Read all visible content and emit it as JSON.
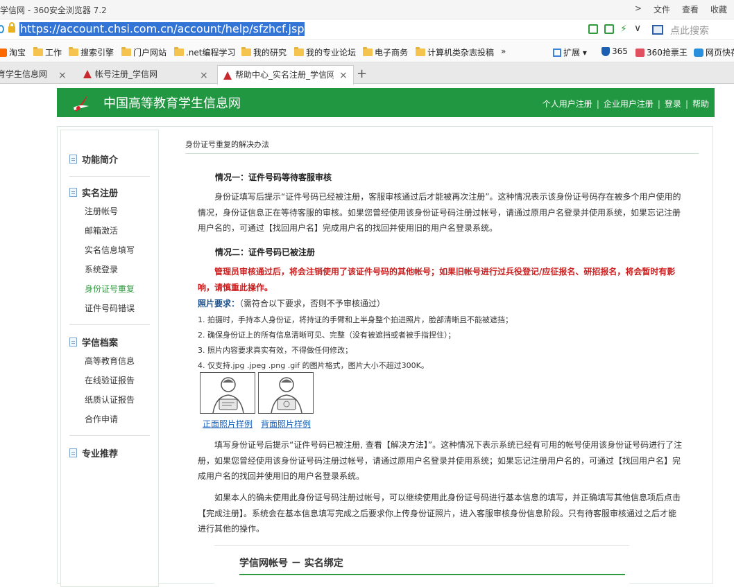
{
  "browser": {
    "title": "学信网 - 360安全浏览器 7.2",
    "menu": [
      ">",
      "文件",
      "查看",
      "收藏"
    ],
    "url": "https://account.chsi.com.cn/account/help/sfzhcf.jsp",
    "search_placeholder": "点此搜索",
    "chevron": "∨",
    "bookmarks": [
      {
        "label": "淘宝",
        "icon": "taobao-icon"
      },
      {
        "label": "工作",
        "icon": "folder-icon"
      },
      {
        "label": "搜索引擎",
        "icon": "folder-icon"
      },
      {
        "label": "门户网站",
        "icon": "folder-icon"
      },
      {
        "label": ".net编程学习",
        "icon": "folder-icon"
      },
      {
        "label": "我的研究",
        "icon": "folder-icon"
      },
      {
        "label": "我的专业论坛",
        "icon": "folder-icon"
      },
      {
        "label": "电子商务",
        "icon": "folder-icon"
      },
      {
        "label": "计算机类杂志投稿",
        "icon": "folder-icon"
      }
    ],
    "more_bookmarks": "»",
    "toolbar_items": [
      {
        "label": "扩展 ▾",
        "icon": "extension-icon"
      },
      {
        "label": "365",
        "icon": "shield-icon"
      },
      {
        "label": "360抢票王",
        "icon": "train-ticket-icon"
      },
      {
        "label": "网页快存",
        "icon": "web-save-icon"
      }
    ],
    "tabs": [
      {
        "label": "育学生信息网",
        "active": false
      },
      {
        "label": "帐号注册_学信网",
        "active": false
      },
      {
        "label": "帮助中心_实名注册_学信网",
        "active": true
      }
    ],
    "close_glyph": "×",
    "new_tab": "+"
  },
  "site": {
    "name": "中国高等教育学生信息网",
    "brand_color": "#229741",
    "nav": [
      "个人用户注册",
      "企业用户注册",
      "登录",
      "帮助"
    ],
    "nav_sep": "|"
  },
  "sidebar": {
    "sections": [
      {
        "title": "功能简介",
        "items": []
      },
      {
        "title": "实名注册",
        "items": [
          "注册帐号",
          "邮箱激活",
          "实名信息填写",
          "系统登录",
          "身份证号重复",
          "证件号码错误"
        ]
      },
      {
        "title": "学信档案",
        "items": [
          "高等教育信息",
          "在线验证报告",
          "纸质认证报告",
          "合作申请"
        ]
      },
      {
        "title": "专业推荐",
        "items": []
      }
    ],
    "active_item": "身份证号重复"
  },
  "main": {
    "breadcrumb": "身份证号重复的解决办法",
    "case1_title": "情况一：证件号码等待客服审核",
    "case1_text": "身份证填写后提示“证件号码已经被注册，客服审核通过后才能被再次注册”。这种情况表示该身份证号码存在被多个用户使用的情况，身份证信息正在等待客服的审核。如果您曾经使用该身份证号码注册过帐号，请通过原用户名登录并使用系统，如果忘记注册用户名的，可通过【找回用户名】完成用户名的找回并使用旧的用户名登录系统。",
    "case2_title": "情况二：证件号码已被注册",
    "warning": "管理员审核通过后，将会注销使用了该证件号码的其他帐号；如果旧帐号进行过兵役登记/应征报名、研招报名，将会暂时有影响，请慎重此操作。",
    "photo_req_label": "照片要求：",
    "photo_req_note": "（需符合以下要求，否则不予审核通过）",
    "photo_rules": [
      "1. 拍摄时，手持本人身份证，将持证的手臂和上半身整个拍进照片，脸部清晰且不能被遮挡；",
      "2. 确保身份证上的所有信息清晰可见、完整（没有被遮挡或者被手指捏住）；",
      "3. 照片内容要求真实有效，不得做任何修改；",
      "4. 仅支持.jpg .jpeg .png .gif 的图片格式，图片大小不超过300K。"
    ],
    "photo_links": [
      "正面照片样例",
      "背面照片样例"
    ],
    "case2_text": "填写身份证号后提示“证件号码已被注册, 查看【解决方法】”。这种情况下表示系统已经有可用的帐号使用该身份证号码进行了注册，如果您曾经使用该身份证号码注册过帐号，请通过原用户名登录并使用系统；如果忘记注册用户名的，可通过【找回用户名】完成用户名的找回并使用旧的用户名登录系统。",
    "case3_text": "如果本人的确未使用此身份证号码注册过帐号，可以继续使用此身份证号码进行基本信息的填写，并正确填写其他信息项后点击【完成注册】。系统会在基本信息填写完成之后要求你上传身份证照片，进入客服审核身份信息阶段。只有待客服审核通过之后才能进行其他的操作。",
    "binding_title": "学信网帐号 － 实名绑定"
  }
}
